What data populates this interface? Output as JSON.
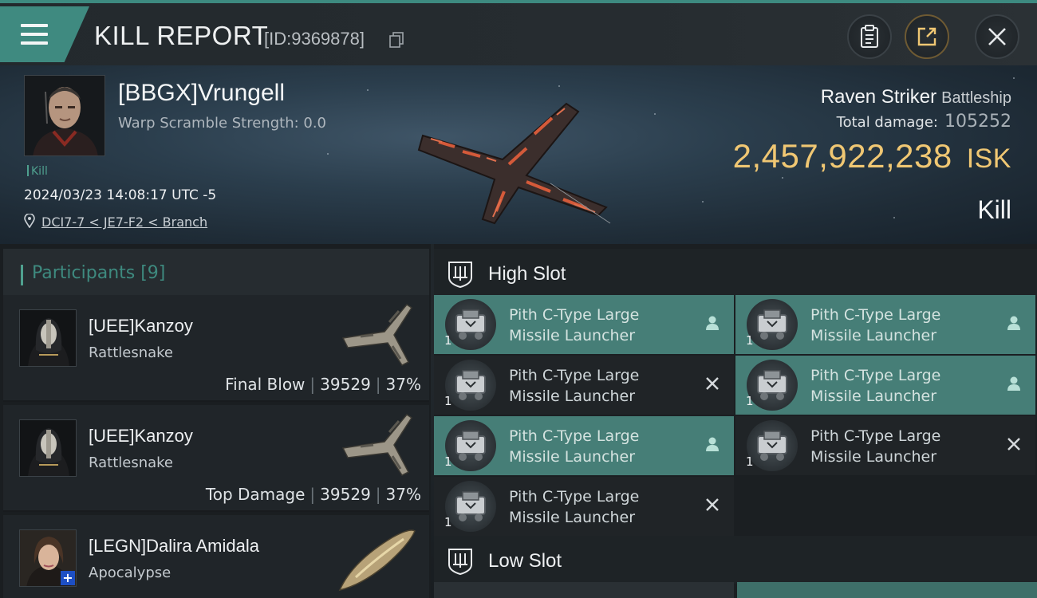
{
  "header": {
    "title": "KILL REPORT",
    "report_id": "[ID:9369878]",
    "accent": "#3f8a80"
  },
  "victim": {
    "name": "[BBGX]Vrungell",
    "warp_scramble": "Warp Scramble Strength: 0.0",
    "kill_tag": "Kill",
    "timestamp": "2024/03/23 14:08:17 UTC -5",
    "location": "DCI7-7 < JE7-F2 < Branch"
  },
  "ship": {
    "name": "Raven Striker",
    "class": "Battleship",
    "total_damage_label": "Total damage:",
    "total_damage": "105252",
    "isk_value": "2,457,922,238",
    "isk_unit": "ISK",
    "result": "Kill",
    "isk_color": "#f0c773"
  },
  "participants": {
    "title": "Participants [9]",
    "rows": [
      {
        "name": "[UEE]Kanzoy",
        "ship": "Rattlesnake",
        "role": "Final Blow",
        "damage": "39529",
        "percent": "37%"
      },
      {
        "name": "[UEE]Kanzoy",
        "ship": "Rattlesnake",
        "role": "Top Damage",
        "damage": "39529",
        "percent": "37%"
      },
      {
        "name": "[LEGN]Dalira Amidala",
        "ship": "Apocalypse"
      }
    ]
  },
  "fitting": {
    "high_slot_title": "High Slot",
    "low_slot_title": "Low Slot",
    "high_slots": [
      {
        "line1": "Pith C-Type Large",
        "line2": "Missile Launcher",
        "qty": "1",
        "state": "dropped",
        "mark": "person-icon"
      },
      {
        "line1": "Pith C-Type Large",
        "line2": "Missile Launcher",
        "qty": "1",
        "state": "dropped",
        "mark": "person-icon"
      },
      {
        "line1": "Pith C-Type Large",
        "line2": "Missile Launcher",
        "qty": "1",
        "state": "destroyed",
        "mark": "x-icon"
      },
      {
        "line1": "Pith C-Type Large",
        "line2": "Missile Launcher",
        "qty": "1",
        "state": "dropped",
        "mark": "person-icon"
      },
      {
        "line1": "Pith C-Type Large",
        "line2": "Missile Launcher",
        "qty": "1",
        "state": "dropped",
        "mark": "person-icon"
      },
      {
        "line1": "Pith C-Type Large",
        "line2": "Missile Launcher",
        "qty": "1",
        "state": "destroyed",
        "mark": "x-icon"
      },
      {
        "line1": "Pith C-Type Large",
        "line2": "Missile Launcher",
        "qty": "1",
        "state": "destroyed",
        "mark": "x-icon"
      }
    ]
  }
}
